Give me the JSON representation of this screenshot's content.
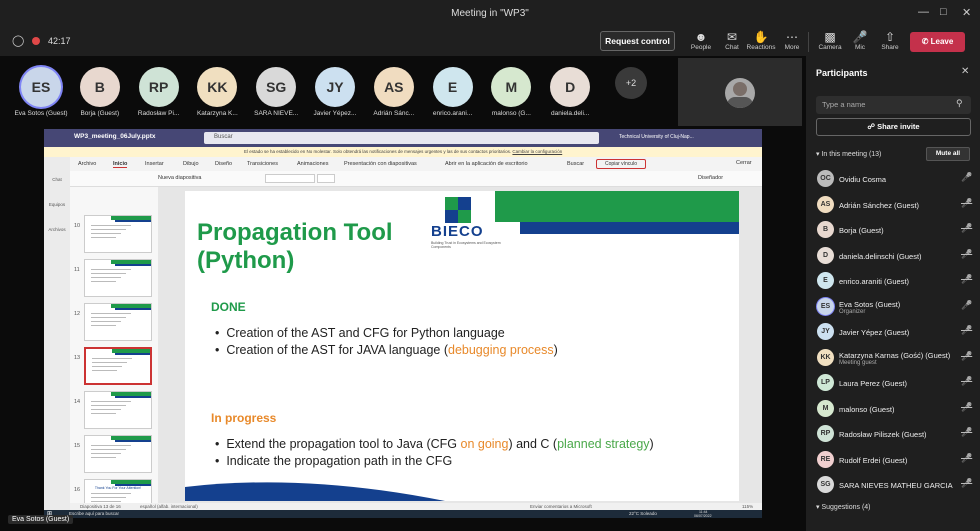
{
  "window": {
    "title": "Meeting in \"WP3\""
  },
  "topbar": {
    "timer": "42:17",
    "request_control": "Request control",
    "items": [
      {
        "label": "People",
        "icon": "people-icon"
      },
      {
        "label": "Chat",
        "icon": "chat-icon"
      },
      {
        "label": "Reactions",
        "icon": "reactions-icon"
      },
      {
        "label": "More",
        "icon": "more-icon"
      },
      {
        "label": "Camera",
        "icon": "camera-icon"
      },
      {
        "label": "Mic",
        "icon": "mic-icon"
      },
      {
        "label": "Share",
        "icon": "share-icon"
      }
    ],
    "leave": "Leave"
  },
  "attendees": [
    {
      "initials": "ES",
      "name": "Eva Sotos (Guest)",
      "color": "#c9d6ea"
    },
    {
      "initials": "B",
      "name": "Borja (Guest)",
      "color": "#e8d8cf"
    },
    {
      "initials": "RP",
      "name": "Radosław Pi...",
      "color": "#cfe3d6"
    },
    {
      "initials": "KK",
      "name": "Katarzyna K...",
      "color": "#f0dfc0"
    },
    {
      "initials": "SG",
      "name": "SARA NIEVE...",
      "color": "#d9d9d9"
    },
    {
      "initials": "JY",
      "name": "Javier Yépez...",
      "color": "#cce0f0"
    },
    {
      "initials": "AS",
      "name": "Adrián Sánc...",
      "color": "#f0dcc0"
    },
    {
      "initials": "E",
      "name": "enrico.arani...",
      "color": "#cfe6ee"
    },
    {
      "initials": "M",
      "name": "malonso (G...",
      "color": "#d6e8cf"
    },
    {
      "initials": "D",
      "name": "daniela.deli...",
      "color": "#e8ddd6"
    }
  ],
  "more_count": "+2",
  "participants": {
    "title": "Participants",
    "search_placeholder": "Type a name",
    "share_invite": "Share invite",
    "in_meeting": "In this meeting (13)",
    "mute_all": "Mute all",
    "list": [
      {
        "initials": "OC",
        "name": "Ovidiu Cosma",
        "sub": "",
        "color": "#bbb",
        "mic": "mic-icon"
      },
      {
        "initials": "AS",
        "name": "Adrián Sánchez (Guest)",
        "sub": "",
        "color": "#f0dcc0",
        "mic": "mic-off-icon"
      },
      {
        "initials": "B",
        "name": "Borja (Guest)",
        "sub": "",
        "color": "#e8d8cf",
        "mic": "mic-off-icon"
      },
      {
        "initials": "D",
        "name": "daniela.delinschi (Guest)",
        "sub": "",
        "color": "#e8ddd6",
        "mic": "mic-off-icon"
      },
      {
        "initials": "E",
        "name": "enrico.araniti (Guest)",
        "sub": "",
        "color": "#cfe6ee",
        "mic": "mic-off-icon"
      },
      {
        "initials": "ES",
        "name": "Eva Sotos (Guest)",
        "sub": "Organizer",
        "color": "#c9d6ea",
        "mic": "mic-icon"
      },
      {
        "initials": "JY",
        "name": "Javier Yépez (Guest)",
        "sub": "",
        "color": "#cce0f0",
        "mic": "mic-off-icon"
      },
      {
        "initials": "KK",
        "name": "Katarzyna Karnas (Gość) (Guest)",
        "sub": "Meeting guest",
        "color": "#f0dfc0",
        "mic": "mic-off-icon"
      },
      {
        "initials": "LP",
        "name": "Laura Perez (Guest)",
        "sub": "",
        "color": "#cfe8d6",
        "mic": "mic-off-icon"
      },
      {
        "initials": "M",
        "name": "malonso (Guest)",
        "sub": "",
        "color": "#d6e8cf",
        "mic": "mic-off-icon"
      },
      {
        "initials": "RP",
        "name": "Radosław Piliszek (Guest)",
        "sub": "",
        "color": "#cfe3d6",
        "mic": "mic-off-icon"
      },
      {
        "initials": "RE",
        "name": "Rudolf Erdei (Guest)",
        "sub": "",
        "color": "#f0cfcf",
        "mic": "mic-off-icon"
      },
      {
        "initials": "SG",
        "name": "SARA NIEVES MATHEU GARCIA (...",
        "sub": "",
        "color": "#d9d9d9",
        "mic": "mic-off-icon"
      }
    ],
    "suggestions": "Suggestions (4)"
  },
  "presenter_label": "Eva Sotos (Guest)",
  "shared": {
    "file": "WP3_meeting_06July.pptx",
    "search": "Buscar",
    "org": "Technical University of Cluj-Nap...",
    "notice": "El estado se ha establecido en No molestar. Solo obtendrá las notificaciones de mensajes urgentes y las de sus contactos prioritarios.",
    "notice_link": "Cambiar la configuración",
    "ribbon_tabs": [
      "Archivo",
      "Inicio",
      "Insertar",
      "Dibujo",
      "Diseño",
      "Transiciones",
      "Animaciones",
      "Presentación con diapositivas",
      "Abrir en la aplicación de escritorio",
      "Buscar"
    ],
    "copy_link": "Copiar vínculo",
    "close": "Cerrar",
    "new_slide": "Nueva diapositiva",
    "designer": "Diseñador",
    "left_rail": [
      "Chat",
      "Equipos",
      "Archivos"
    ],
    "thumb_numbers": [
      "10",
      "11",
      "12",
      "13",
      "14",
      "15",
      "16"
    ],
    "thumb16_text": "Thank You For Your Attention!",
    "slide": {
      "title_line1": "Propagation Tool",
      "title_line2": "(Python)",
      "logo": "BIECO",
      "logo_sub": "Building Trust in Ecosystems and Ecosystem Components",
      "done_heading": "DONE",
      "done_items": [
        {
          "text": "Creation of the AST and CFG for Python language",
          "extra": ""
        },
        {
          "text": "Creation of the AST for JAVA language (",
          "extra": "debugging process",
          ")": ")"
        }
      ],
      "progress_heading": "In progress",
      "p1_a": "Extend the propagation tool to Java (CFG ",
      "p1_b": "on going",
      "p1_c": ") and C (",
      "p1_d": "planned strategy",
      "p1_e": ")",
      "p2": "Indicate the propagation path in the CFG"
    },
    "status": {
      "slide": "Diapositiva 13 de 16",
      "lang": "español (alfab. internacional)",
      "notes": "Enviar comentarios a Microsoft",
      "zoom": "115%"
    },
    "taskbar": {
      "search": "Escribe aquí para buscar",
      "weather": "22°C  Soleado",
      "time": "11:44",
      "date": "06/07/2022"
    }
  },
  "colors": {
    "green": "#1f9a4a",
    "orange": "#e8892a",
    "navy": "#14408e",
    "leave": "#c4314b"
  }
}
